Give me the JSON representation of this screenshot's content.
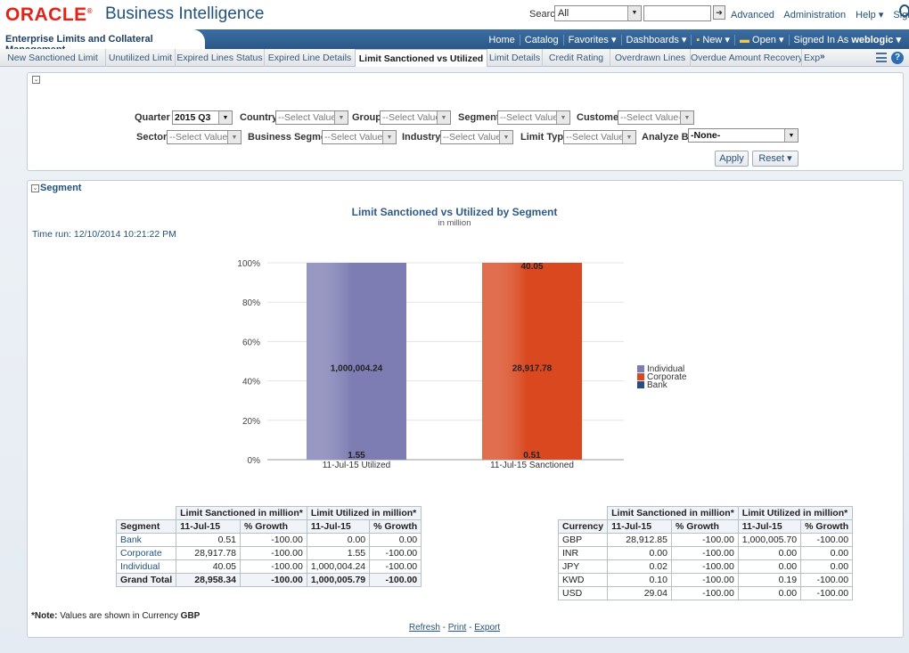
{
  "header": {
    "logo": "ORACLE",
    "app_title": "Business Intelligence",
    "search_label": "Search",
    "search_scope": "All",
    "search_value": "",
    "links": [
      "Advanced",
      "Administration",
      "Help ▾",
      "Sign Out"
    ]
  },
  "bluebar": {
    "dashboard_title": "Enterprise Limits and Collateral Management",
    "nav": [
      "Home",
      "Catalog",
      "Favorites ▾",
      "Dashboards ▾",
      "New ▾",
      "Open ▾"
    ],
    "signed_in_label": "Signed In As",
    "user": "weblogic ▾"
  },
  "tabs": {
    "items": [
      "New Sanctioned Limit",
      "Unutilized Limit",
      "Expired Lines Status",
      "Expired Line Details",
      "Limit Sanctioned vs Utilized",
      "Limit Details",
      "Credit Rating",
      "Overdrawn Lines",
      "Overdue Amount Recovery",
      "Exposur"
    ],
    "more": "»",
    "help": "?"
  },
  "filters": {
    "quarter_label": "Quarter",
    "quarter_value": "2015 Q3",
    "country_label": "Country",
    "group_label": "Group",
    "segment_label": "Segment",
    "customer_label": "Customer",
    "sector_label": "Sector",
    "business_segment_label": "Business Segment",
    "industry_label": "Industry",
    "limit_type_label": "Limit Type",
    "analyze_by_label": "Analyze By",
    "analyze_by_value": "-None-",
    "select_placeholder": "--Select Value--",
    "apply_label": "Apply",
    "reset_label": "Reset ▾"
  },
  "segment_section": {
    "title": "Segment",
    "time_run": "Time run: 12/10/2014 10:21:22 PM"
  },
  "chart_data": {
    "type": "bar",
    "stacked": true,
    "percent": true,
    "title": "Limit Sanctioned vs Utilized by Segment",
    "subtitle": "in million",
    "categories": [
      "11-Jul-15 Utilized",
      "11-Jul-15 Sanctioned"
    ],
    "series": [
      {
        "name": "Individual",
        "values": [
          1000004.24,
          40.05
        ],
        "labels": [
          "1,000,004.24",
          "40.05"
        ],
        "color": "#7d7db3"
      },
      {
        "name": "Corporate",
        "values": [
          1.55,
          28917.78
        ],
        "labels": [
          "1.55",
          "28,917.78"
        ],
        "color": "#d9481f"
      },
      {
        "name": "Bank",
        "values": [
          0.0,
          0.51
        ],
        "labels": [
          "",
          "0.51"
        ],
        "color": "#2b4c7e"
      }
    ],
    "yticks": [
      "0%",
      "20%",
      "40%",
      "60%",
      "80%",
      "100%"
    ],
    "ylim": [
      0,
      100
    ],
    "legend_position": "right"
  },
  "segment_table": {
    "group_headers": [
      "Limit Sanctioned in million*",
      "Limit Utilized in million*"
    ],
    "columns": [
      "Segment",
      "11-Jul-15",
      "% Growth",
      "11-Jul-15",
      "% Growth"
    ],
    "rows": [
      [
        "Bank",
        "0.51",
        "-100.00",
        "0.00",
        "0.00"
      ],
      [
        "Corporate",
        "28,917.78",
        "-100.00",
        "1.55",
        "-100.00"
      ],
      [
        "Individual",
        "40.05",
        "-100.00",
        "1,000,004.24",
        "-100.00"
      ]
    ],
    "total": [
      "Grand Total",
      "28,958.34",
      "-100.00",
      "1,000,005.79",
      "-100.00"
    ]
  },
  "currency_table": {
    "group_headers": [
      "Limit Sanctioned in million*",
      "Limit Utilized in million*"
    ],
    "columns": [
      "Currency",
      "11-Jul-15",
      "% Growth",
      "11-Jul-15",
      "% Growth"
    ],
    "rows": [
      [
        "GBP",
        "28,912.85",
        "-100.00",
        "1,000,005.70",
        "-100.00"
      ],
      [
        "INR",
        "0.00",
        "-100.00",
        "0.00",
        "0.00"
      ],
      [
        "JPY",
        "0.02",
        "-100.00",
        "0.00",
        "0.00"
      ],
      [
        "KWD",
        "0.10",
        "-100.00",
        "0.19",
        "-100.00"
      ],
      [
        "USD",
        "29.04",
        "-100.00",
        "0.00",
        "-100.00"
      ]
    ]
  },
  "footer": {
    "note_label": "*Note:",
    "note_text": " Values are shown in Currency ",
    "note_currency": "GBP",
    "links": [
      "Refresh",
      "Print",
      "Export"
    ],
    "separator": " - "
  }
}
